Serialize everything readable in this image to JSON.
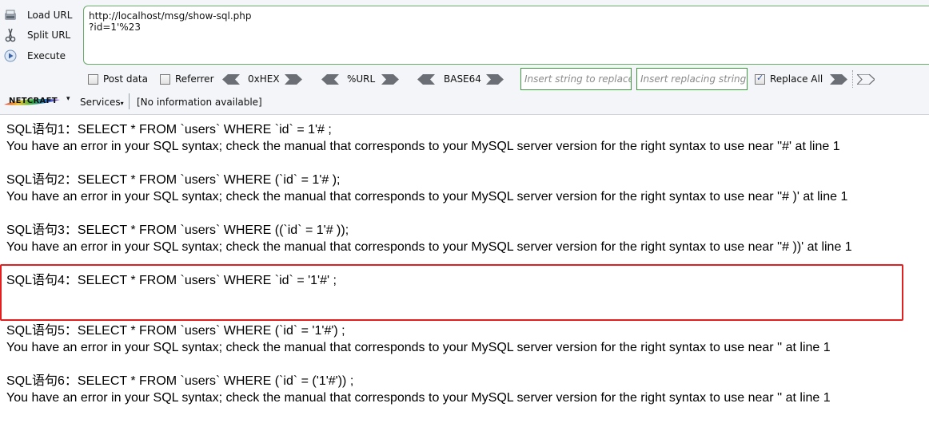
{
  "sidebar": {
    "load_url": "Load URL",
    "split_url": "Split URL",
    "execute": "Execute"
  },
  "url": {
    "line1": "http://localhost/msg/show-sql.php",
    "line2": "?id=1'%23"
  },
  "options": {
    "post_data": "Post data",
    "post_data_checked": false,
    "referrer": "Referrer",
    "referrer_checked": false,
    "hex": "0xHEX",
    "url_enc": "%URL",
    "base64": "BASE64",
    "insert_replace_placeholder": "Insert string to replace",
    "insert_replacing_placeholder": "Insert replacing string",
    "replace_all": "Replace All",
    "replace_all_checked": true
  },
  "netcraft": {
    "logo": "NETCRAFT",
    "services": "Services",
    "info": "[No information available]"
  },
  "results": [
    {
      "sql": "SQL语句1：SELECT * FROM `users` WHERE `id` = 1'# ;",
      "error": "You have an error in your SQL syntax; check the manual that corresponds to your MySQL server version for the right syntax to use near ''#' at line 1"
    },
    {
      "sql": "SQL语句2：SELECT * FROM `users` WHERE (`id` = 1'# );",
      "error": "You have an error in your SQL syntax; check the manual that corresponds to your MySQL server version for the right syntax to use near ''# )' at line 1"
    },
    {
      "sql": "SQL语句3：SELECT * FROM `users` WHERE ((`id` = 1'# ));",
      "error": "You have an error in your SQL syntax; check the manual that corresponds to your MySQL server version for the right syntax to use near ''# ))' at line 1"
    },
    {
      "sql": "SQL语句4：SELECT * FROM `users` WHERE `id` = '1'#' ;",
      "error": ""
    },
    {
      "sql": "SQL语句5：SELECT * FROM `users` WHERE (`id` = '1'#') ;",
      "error": "You have an error in your SQL syntax; check the manual that corresponds to your MySQL server version for the right syntax to use near '' at line 1"
    },
    {
      "sql": "SQL语句6：SELECT * FROM `users` WHERE (`id` = ('1'#')) ;",
      "error": "You have an error in your SQL syntax; check the manual that corresponds to your MySQL server version for the right syntax to use near '' at line 1"
    }
  ],
  "colors": {
    "highlight": "#e02020",
    "url_border": "#6aaa6a",
    "input_border": "#3c9a3c"
  }
}
